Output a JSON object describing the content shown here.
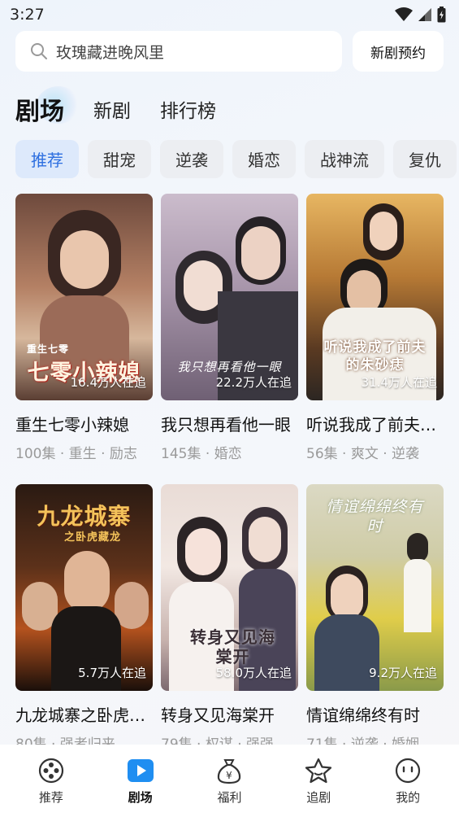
{
  "status": {
    "time": "3:27"
  },
  "search": {
    "placeholder": "玫瑰藏进晚风里",
    "reserve_label": "新剧预约"
  },
  "main_tabs": [
    {
      "label": "剧场",
      "active": true
    },
    {
      "label": "新剧",
      "active": false
    },
    {
      "label": "排行榜",
      "active": false
    }
  ],
  "categories": [
    {
      "label": "推荐",
      "active": true
    },
    {
      "label": "甜宠",
      "active": false
    },
    {
      "label": "逆袭",
      "active": false
    },
    {
      "label": "婚恋",
      "active": false
    },
    {
      "label": "战神流",
      "active": false
    },
    {
      "label": "复仇",
      "active": false
    }
  ],
  "dramas": [
    {
      "title": "重生七零小辣媳",
      "watchers": "16.4万人在追",
      "meta": "100集 · 重生 · 励志",
      "poster_text": "七零小辣媳",
      "poster_subtext": "重生七零",
      "colors": [
        "#8a5a48",
        "#c9977a",
        "#3b2a24"
      ]
    },
    {
      "title": "我只想再看他一眼",
      "watchers": "22.2万人在追",
      "meta": "145集 · 婚恋",
      "poster_text": "我只想再看他一眼",
      "poster_subtext": "",
      "colors": [
        "#c6b8c8",
        "#8d7f96",
        "#504659"
      ]
    },
    {
      "title": "听说我成了前夫的朱砂痣",
      "watchers": "31.4万人在追",
      "meta": "56集 · 爽文 · 逆袭",
      "poster_text": "听说我成了前夫的朱砂痣",
      "poster_subtext": "",
      "colors": [
        "#d8a650",
        "#8c5a2a",
        "#2b2a2a"
      ]
    },
    {
      "title": "九龙城寨之卧虎藏龙",
      "watchers": "5.7万人在追",
      "meta": "80集 · 强者归来",
      "poster_text": "九龙城寨",
      "poster_subtext": "之卧虎藏龙",
      "colors": [
        "#3a2416",
        "#a2461e",
        "#140c08"
      ]
    },
    {
      "title": "转身又见海棠开",
      "watchers": "58.0万人在追",
      "meta": "79集 · 权谋 · 强强",
      "poster_text": "转身又见海棠开",
      "poster_subtext": "",
      "colors": [
        "#efe0d8",
        "#c9a9a2",
        "#6b5a63"
      ]
    },
    {
      "title": "情谊绵绵终有时",
      "watchers": "9.2万人在追",
      "meta": "71集 · 逆袭 · 婚姻",
      "poster_text": "情谊绵绵终有时",
      "poster_subtext": "",
      "colors": [
        "#d9d7b0",
        "#e2cf3a",
        "#7a8a5a"
      ]
    }
  ],
  "bottom_nav": [
    {
      "label": "推荐",
      "icon": "film-reel-icon",
      "active": false
    },
    {
      "label": "剧场",
      "icon": "play-icon",
      "active": true
    },
    {
      "label": "福利",
      "icon": "money-bag-icon",
      "active": false
    },
    {
      "label": "追剧",
      "icon": "star-icon",
      "active": false
    },
    {
      "label": "我的",
      "icon": "face-icon",
      "active": false
    }
  ]
}
